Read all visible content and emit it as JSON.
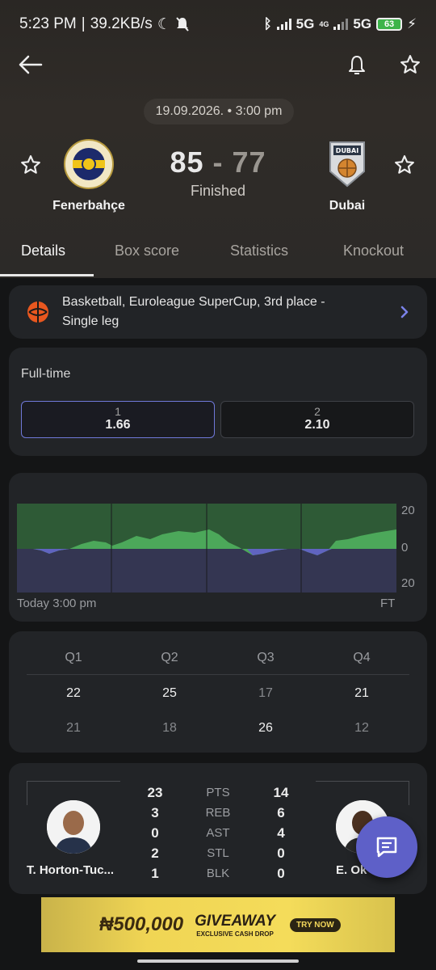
{
  "status_bar": {
    "time": "5:23 PM",
    "speed": "39.2KB/s",
    "network1": "5G",
    "network2_small": "4G",
    "network2": "5G",
    "battery": "63"
  },
  "match": {
    "date_time": "19.09.2026. • 3:00 pm",
    "home_team": "Fenerbahçe",
    "away_team": "Dubai",
    "home_score": "85",
    "away_score": "77",
    "separator": "-",
    "state": "Finished",
    "away_logo_text": "DUBAI"
  },
  "tabs": [
    "Details",
    "Box score",
    "Statistics",
    "Knockout"
  ],
  "competition": {
    "line1": "Basketball, Euroleague SuperCup, 3rd place -",
    "line2": "Single leg"
  },
  "odds": {
    "title": "Full-time",
    "options": [
      {
        "label": "1",
        "value": "1.66",
        "selected": true
      },
      {
        "label": "2",
        "value": "2.10",
        "selected": false
      }
    ]
  },
  "momentum": {
    "axis_top": "20",
    "axis_mid": "0",
    "axis_bottom": "20",
    "start_label": "Today 3:00 pm",
    "end_label": "FT",
    "home_color": "#3f8a4a",
    "away_color": "#50529a"
  },
  "quarters": {
    "headers": [
      "Q1",
      "Q2",
      "Q3",
      "Q4"
    ],
    "home": [
      "22",
      "25",
      "17",
      "21"
    ],
    "away": [
      "21",
      "18",
      "26",
      "12"
    ]
  },
  "top_players": {
    "home_name": "T. Horton-Tuc...",
    "away_name": "E. Ok",
    "labels": [
      "PTS",
      "REB",
      "AST",
      "STL",
      "BLK"
    ],
    "home_values": [
      "23",
      "3",
      "0",
      "2",
      "1"
    ],
    "away_values": [
      "14",
      "6",
      "4",
      "0",
      "0"
    ]
  },
  "ad": {
    "amount": "₦500,000",
    "title": "GIVEAWAY",
    "subtitle": "EXCLUSIVE CASH DROP",
    "cta": "TRY NOW"
  }
}
